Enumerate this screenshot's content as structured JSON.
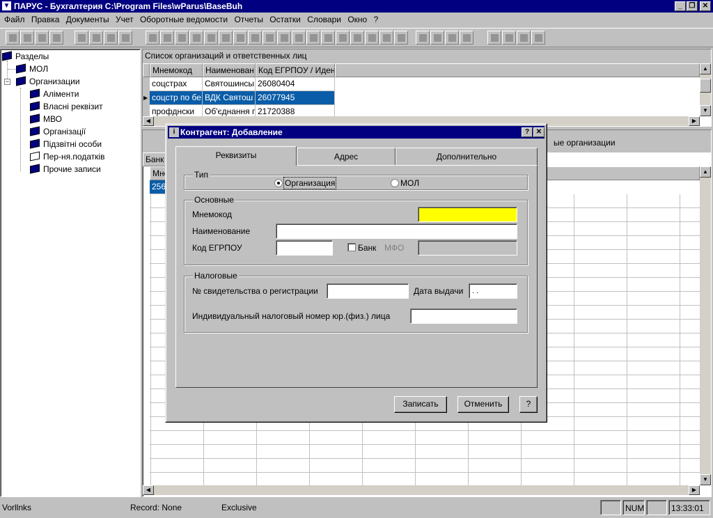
{
  "app": {
    "title": "ПАРУС - Бухгалтерия  C:\\Program Files\\wParus\\BaseBuh"
  },
  "menu": [
    "Файл",
    "Правка",
    "Документы",
    "Учет",
    "Оборотные ведомости",
    "Отчеты",
    "Остатки",
    "Словари",
    "Окно",
    "?"
  ],
  "tree": {
    "root": "Разделы",
    "items": [
      "МОЛ",
      "Организации",
      "Аліменти",
      "Власні реквізит",
      "МВО",
      "Організації",
      "Підзвітні особи",
      "Пер-ня.податків",
      "Прочие записи"
    ]
  },
  "top_panel": {
    "title": "Список организаций и ответственных лиц",
    "columns": [
      "Мнемокод",
      "Наименован",
      "Код ЕГРПОУ / Идент"
    ],
    "rows": [
      [
        "соцстрах",
        "Святошинсы",
        "26080404"
      ],
      [
        "соцстр по бе",
        "ВДК Святош",
        "26077945"
      ],
      [
        "профднски",
        "Об'єднання п",
        "21720388"
      ]
    ]
  },
  "bottom_panel": {
    "tab_fragment": "Банк",
    "col_fragment": "Мне",
    "value_fragment": "256",
    "right_label": "ые организации"
  },
  "dialog": {
    "title": "Контрагент: Добавление",
    "help_btn": "?",
    "close_btn": "✕",
    "tabs": [
      "Реквизиты",
      "Адрес",
      "Дополнительно"
    ],
    "type_group": "Тип",
    "radio_org": "Организация",
    "radio_mol": "МОЛ",
    "main_group": "Основные",
    "mnemocode_label": "Мнемокод",
    "name_label": "Наименование",
    "egrpou_label": "Код ЕГРПОУ",
    "bank_label": "Банк",
    "mfo_label": "МФО",
    "tax_group": "Налоговые",
    "cert_label": "№ свидетельства о регистрации",
    "issue_date_label": "Дата выдачи",
    "issue_date_value": " .  .",
    "inn_label": "Индивидуальный налоговый номер юр.(физ.) лица",
    "save_btn": "Записать",
    "cancel_btn": "Отменить",
    "help_btn2": "?",
    "colors": {
      "mnemocode_bg": "#ffff00"
    }
  },
  "status": {
    "left": "Vorllnks",
    "record": "Record: None",
    "mode": "Exclusive",
    "num": "NUM",
    "time": "13:33:01"
  }
}
